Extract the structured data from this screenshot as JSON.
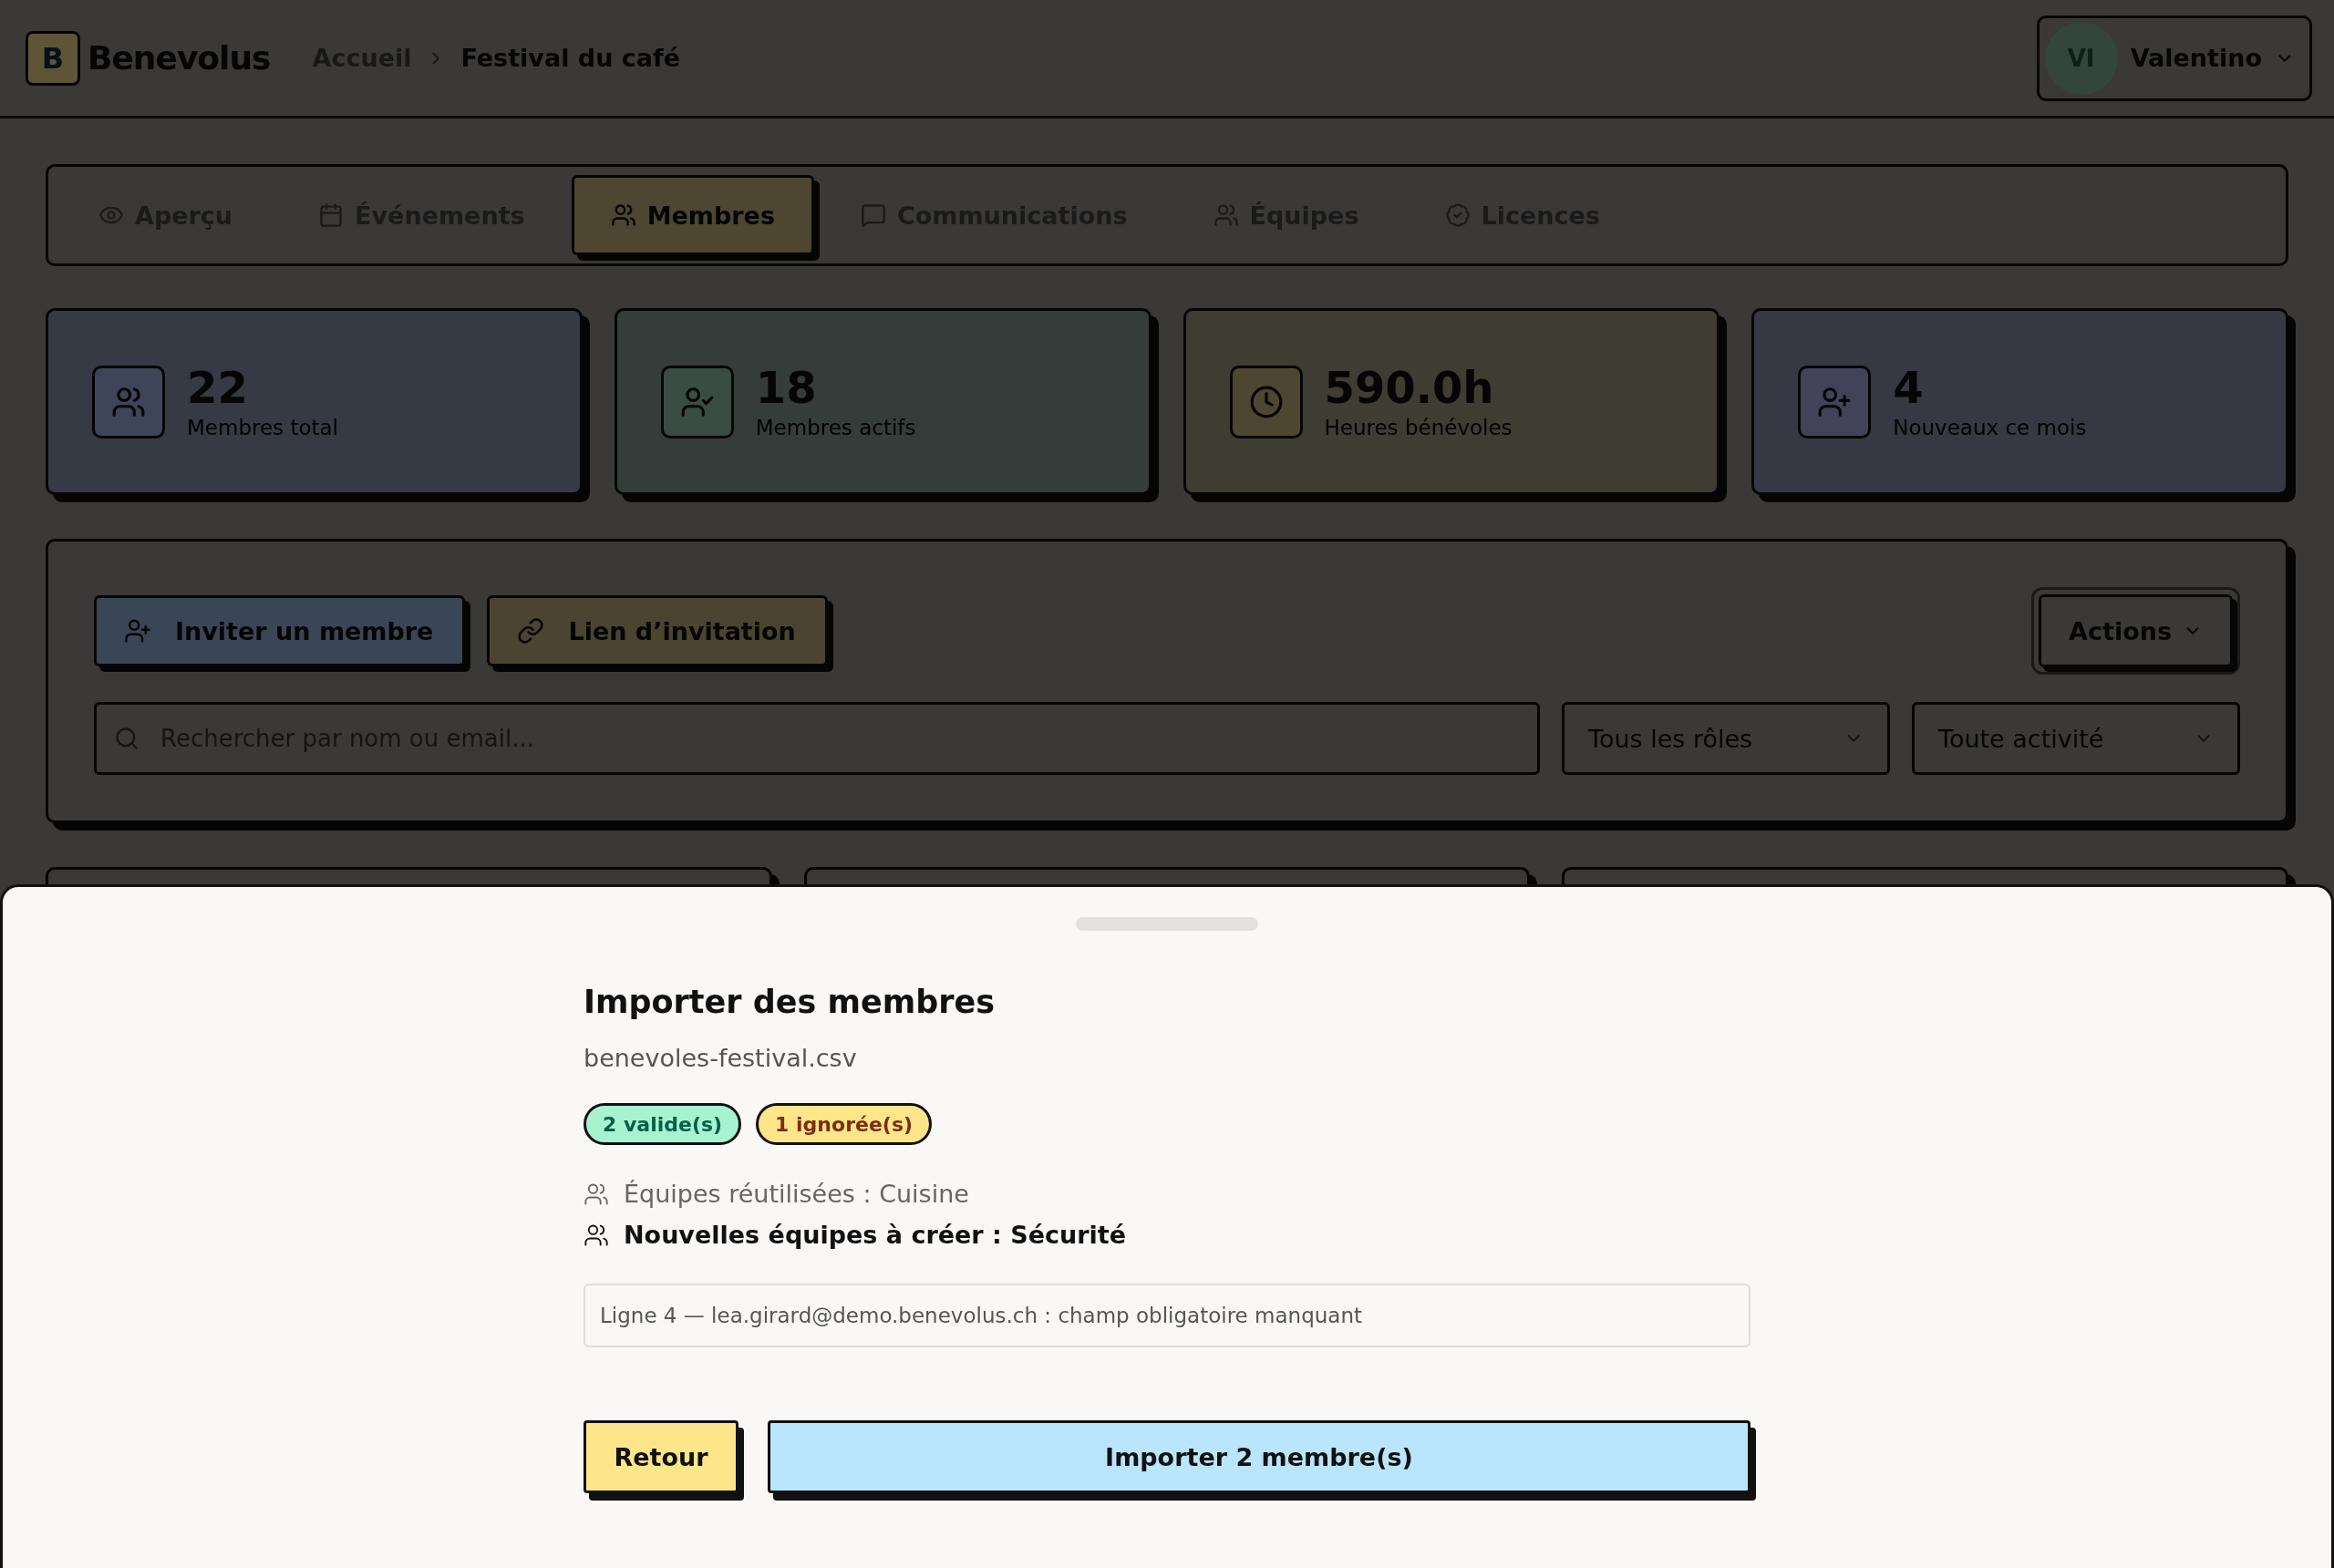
{
  "header": {
    "brand": "Benevolus",
    "logo_letter": "B",
    "breadcrumb": [
      "Accueil",
      "Festival du café"
    ],
    "user": {
      "initials": "VI",
      "name": "Valentino"
    }
  },
  "tabs": [
    {
      "label": "Aperçu",
      "selected": false
    },
    {
      "label": "Événements",
      "selected": false
    },
    {
      "label": "Membres",
      "selected": true
    },
    {
      "label": "Communications",
      "selected": false
    },
    {
      "label": "Équipes",
      "selected": false
    },
    {
      "label": "Licences",
      "selected": false
    }
  ],
  "stats": [
    {
      "value": "22",
      "label": "Membres total"
    },
    {
      "value": "18",
      "label": "Membres actifs"
    },
    {
      "value": "590.0h",
      "label": "Heures bénévoles"
    },
    {
      "value": "4",
      "label": "Nouveaux ce mois"
    }
  ],
  "toolbar": {
    "buttons": [
      "Inviter un membre",
      "Lien d’invitation"
    ],
    "actions": "Actions",
    "search": {
      "placeholder": "Rechercher par nom ou email..."
    },
    "filters": [
      "Tous les rôles",
      "Toute activité"
    ]
  },
  "sheet": {
    "title": "Importer des membres",
    "filename": "benevoles-festival.csv",
    "badges": [
      {
        "label": "2 valide(s)",
        "kind": "valid"
      },
      {
        "label": "1 ignorée(s)",
        "kind": "ignored"
      }
    ],
    "teams": [
      {
        "text": "Équipes réutilisées : Cuisine",
        "kind": "reused"
      },
      {
        "text": "Nouvelles équipes à créer : Sécurité",
        "kind": "new"
      }
    ],
    "errors": [
      "Ligne 4 — lea.girard@demo.benevolus.ch : champ obligatoire manquant"
    ],
    "back": "Retour",
    "submit": "Importer 2 membre(s)"
  }
}
